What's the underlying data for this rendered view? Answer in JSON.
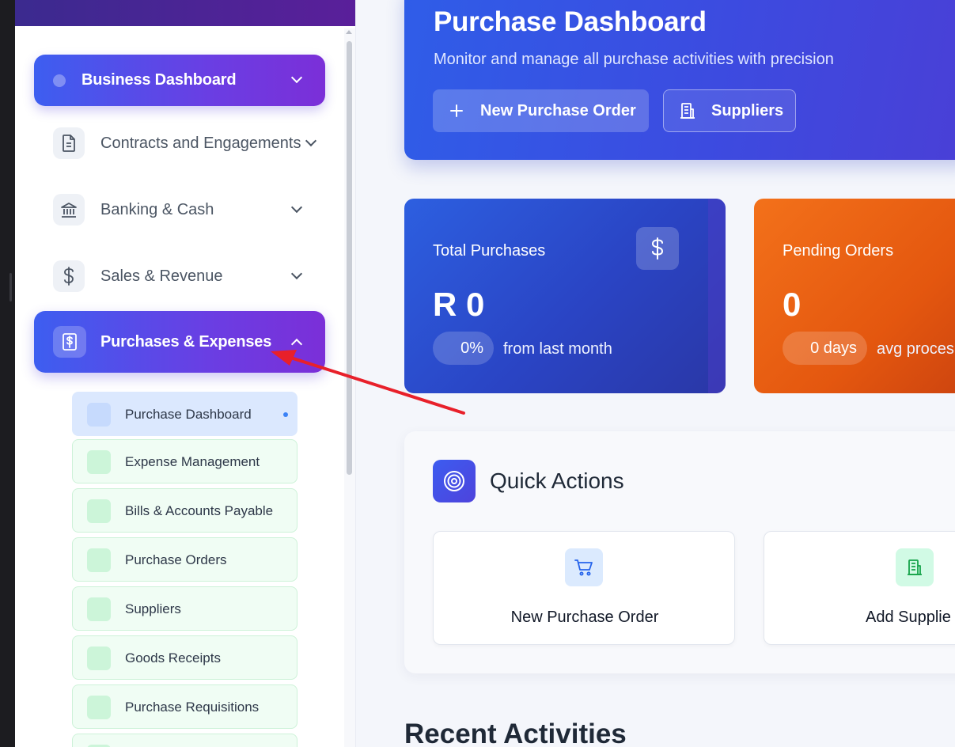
{
  "colors": {
    "accent_gradient_start": "#3d5ef0",
    "accent_gradient_end": "#7b2fd8",
    "blue_card": "#2d5fe0",
    "orange_card": "#f3711a",
    "annotation_arrow": "#e8202a"
  },
  "sidebar": {
    "top_item": {
      "label": "Business Dashboard",
      "icon": "circle-dot-icon"
    },
    "items": [
      {
        "label": "Contracts and Engagements",
        "icon": "document-icon"
      },
      {
        "label": "Banking & Cash",
        "icon": "bank-icon"
      },
      {
        "label": "Sales & Revenue",
        "icon": "dollar-icon"
      }
    ],
    "active_item": {
      "label": "Purchases & Expenses",
      "icon": "receipt-dollar-icon"
    },
    "sub_items": [
      {
        "label": "Purchase Dashboard",
        "current": true
      },
      {
        "label": "Expense Management"
      },
      {
        "label": "Bills & Accounts Payable"
      },
      {
        "label": "Purchase Orders"
      },
      {
        "label": "Suppliers"
      },
      {
        "label": "Goods Receipts"
      },
      {
        "label": "Purchase Requisitions"
      }
    ]
  },
  "header": {
    "title": "Purchase Dashboard",
    "subtitle": "Monitor and manage all purchase activities with precision",
    "new_order_label": "New Purchase Order",
    "suppliers_label": "Suppliers"
  },
  "stats": {
    "total_purchases": {
      "label": "Total Purchases",
      "value": "R 0",
      "change": "0%",
      "note": "from last month",
      "icon": "dollar-icon"
    },
    "pending_orders": {
      "label": "Pending Orders",
      "value": "0",
      "change": "0 days",
      "note": "avg proces"
    }
  },
  "quick_actions": {
    "title": "Quick Actions",
    "cards": [
      {
        "label": "New Purchase Order",
        "icon": "cart-icon"
      },
      {
        "label": "Add Supplie",
        "icon": "building-icon"
      }
    ]
  },
  "recent": {
    "title": "Recent Activities"
  }
}
